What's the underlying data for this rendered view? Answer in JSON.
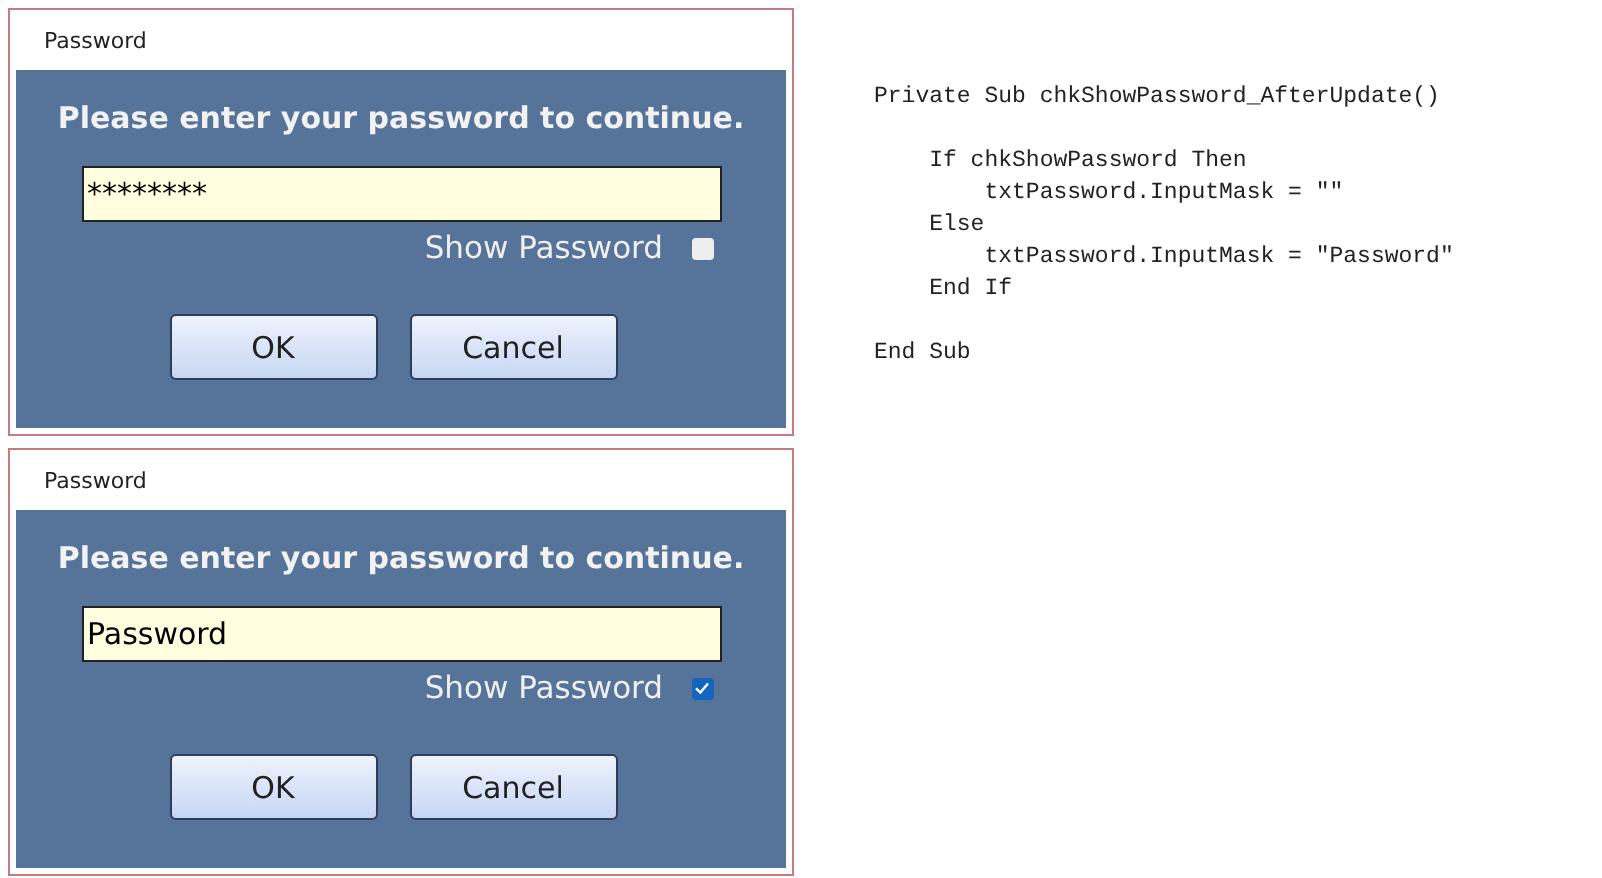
{
  "dialogs": [
    {
      "title": "Password",
      "prompt": "Please enter your password to continue.",
      "password_value": "********",
      "show_password": {
        "label": "Show Password",
        "checked": false
      },
      "buttons": [
        "OK",
        "Cancel"
      ]
    },
    {
      "title": "Password",
      "prompt": "Please enter your password to continue.",
      "password_value": "Password",
      "show_password": {
        "label": "Show Password",
        "checked": true
      },
      "buttons": [
        "OK",
        "Cancel"
      ]
    }
  ],
  "code_blocks": [
    [
      "Private Sub chkShowPassword_AfterUpdate()"
    ],
    [
      "    If chkShowPassword Then",
      "        txtPassword.InputMask = \"\"",
      "    Else",
      "        txtPassword.InputMask = \"Password\"",
      "    End If"
    ],
    [
      "End Sub"
    ]
  ]
}
